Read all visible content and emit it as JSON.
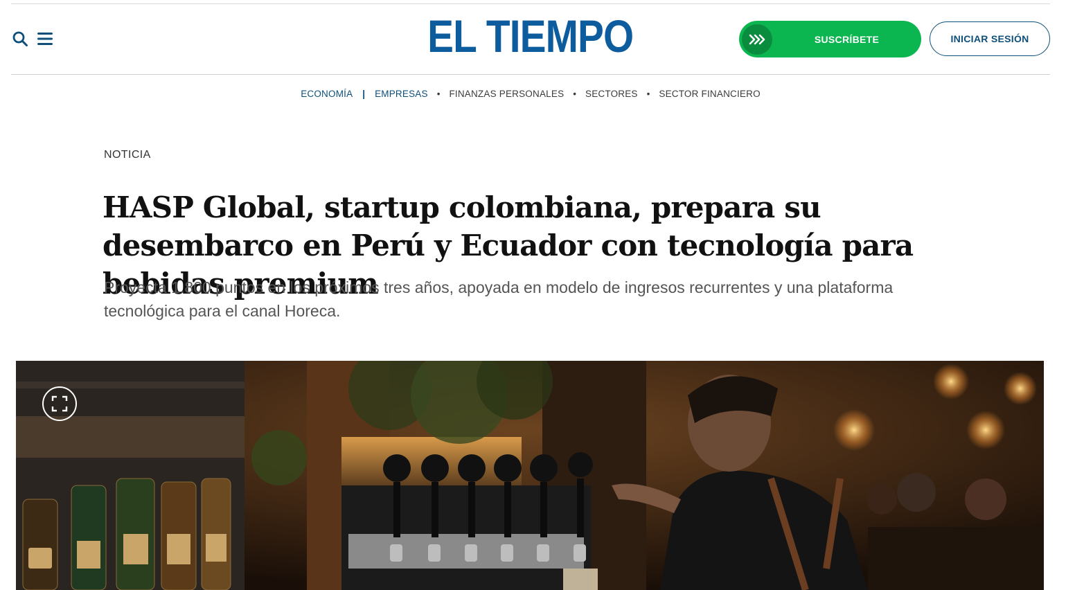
{
  "header": {
    "logo_text": "EL TIEMPO",
    "subscribe_label": "SUSCRÍBETE",
    "login_label": "INICIAR SESIÓN",
    "search_icon": "search-icon",
    "menu_icon": "hamburger-menu-icon",
    "subscribe_icon": "double-chevron-right-icon"
  },
  "subnav": {
    "items": [
      "ECONOMÍA",
      "EMPRESAS",
      "FINANZAS PERSONALES",
      "SECTORES",
      "SECTOR FINANCIERO"
    ]
  },
  "article": {
    "kicker": "NOTICIA",
    "headline": "HASP Global, startup colombiana, prepara su desembarco en Perú y Ecuador con tecnología para bebidas premium",
    "subheadline": "Proyecta 1.800 puntos en los próximos tres años, apoyada en modelo de ingresos recurrentes y una plataforma tecnológica para el canal Horeca.",
    "image_controls": {
      "fullscreen_icon": "expand-fullscreen-icon"
    }
  },
  "colors": {
    "brand_blue": "#0d5c9e",
    "nav_blue": "#0d4f7a",
    "subscribe_green": "#0bb650"
  }
}
